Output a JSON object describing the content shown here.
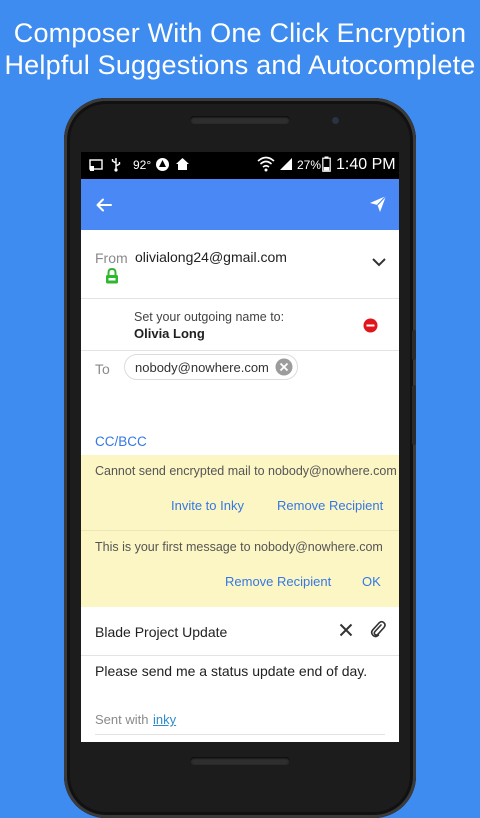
{
  "promo": {
    "line1": "Composer With One Click Encryption",
    "line2": "Helpful Suggestions and Autocomplete"
  },
  "status_bar": {
    "temperature": "92°",
    "battery": "27%",
    "time": "1:40 PM"
  },
  "compose": {
    "from_label": "From",
    "from_value": "olivialong24@gmail.com",
    "outgoing_prompt": "Set your outgoing name to:",
    "outgoing_name": "Olivia Long",
    "to_label": "To",
    "to_chip": "nobody@nowhere.com",
    "cc_bcc": "CC/BCC",
    "warning1": {
      "text": "Cannot send encrypted mail to nobody@nowhere.com",
      "action1": "Invite to Inky",
      "action2": "Remove Recipient"
    },
    "warning2": {
      "text": "This is your first message to nobody@nowhere.com",
      "action1": "Remove Recipient",
      "action2": "OK"
    },
    "subject": "Blade Project Update",
    "body": "Please send me a status update end of day.",
    "signature_prefix": "Sent with",
    "signature_link": "inky"
  },
  "colors": {
    "background": "#3f8cf0",
    "appbar": "#4a89f5",
    "accent": "#3478e5",
    "warning_bg": "#fcf6c4",
    "lock_green": "#2eb82e",
    "remove_red": "#e0161c"
  },
  "icons": {
    "back": "arrow-left",
    "send": "paper-plane",
    "lock": "lock",
    "expand": "chevron-down",
    "remove": "minus-circle",
    "chip_clear": "x-circle",
    "subject_clear": "close",
    "attach": "paperclip"
  }
}
